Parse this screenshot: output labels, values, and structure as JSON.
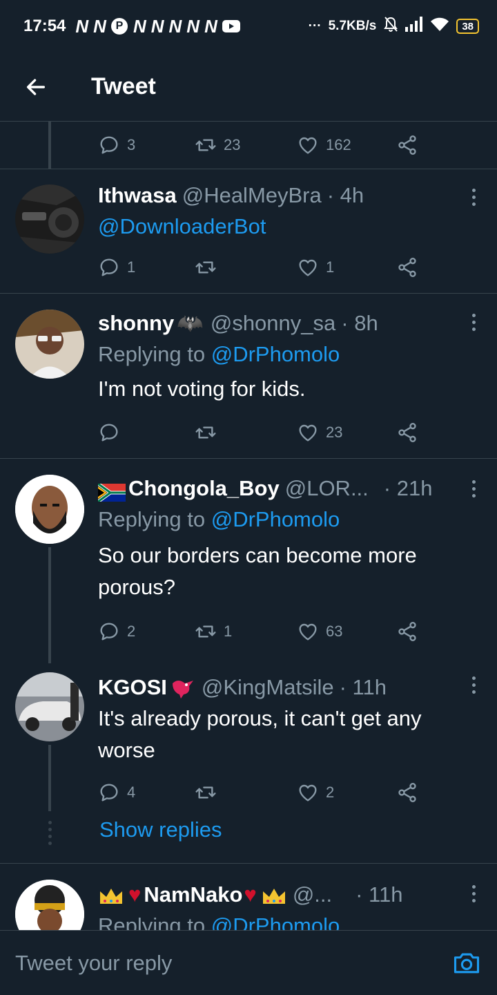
{
  "status_bar": {
    "time": "17:54",
    "notif_glyphs": [
      "N",
      "N",
      "N",
      "N",
      "N",
      "N",
      "N",
      "N"
    ],
    "net_speed": "5.7KB/s",
    "more_dots": "···",
    "battery": "38"
  },
  "app_bar": {
    "title": "Tweet"
  },
  "colors": {
    "background": "#15202b",
    "accent": "#1d9bf0",
    "muted": "#8899a6",
    "divider": "#38444d"
  },
  "top_actions": {
    "replies": "3",
    "retweets": "23",
    "likes": "162"
  },
  "tweets": [
    {
      "name": "Ithwasa",
      "handle": "@HealMeyBra",
      "time": "· 4h",
      "mention": "@DownloaderBot",
      "replies": "1",
      "retweets": "",
      "likes": "1"
    },
    {
      "name": "shonny",
      "name_emoji": "🦇",
      "handle": "@shonny_sa",
      "time": "· 8h",
      "replying_prefix": "Replying to",
      "replying_to": "@DrPhomolo",
      "text": "I'm not voting for kids.",
      "replies": "",
      "retweets": "",
      "likes": "23"
    },
    {
      "name": "Chongola_Boy",
      "handle": "@LOR...",
      "time": "· 21h",
      "replying_prefix": "Replying to",
      "replying_to": "@DrPhomolo",
      "text_line1": "So our borders can become more",
      "text_line2": "porous?",
      "replies": "2",
      "retweets": "1",
      "likes": "63"
    },
    {
      "name": "KGOSI",
      "handle": "@KingMatsile",
      "time": "· 11h",
      "text_line1": "It's already porous, it can't get any",
      "text_line2": "worse",
      "replies": "4",
      "retweets": "",
      "likes": "2",
      "show_replies": "Show replies"
    },
    {
      "name": "NamNako",
      "handle": "@...",
      "time": "· 11h",
      "replying_prefix": "Replying to",
      "replying_to": "@DrPhomolo"
    }
  ],
  "reply_box": {
    "placeholder": "Tweet your reply"
  }
}
